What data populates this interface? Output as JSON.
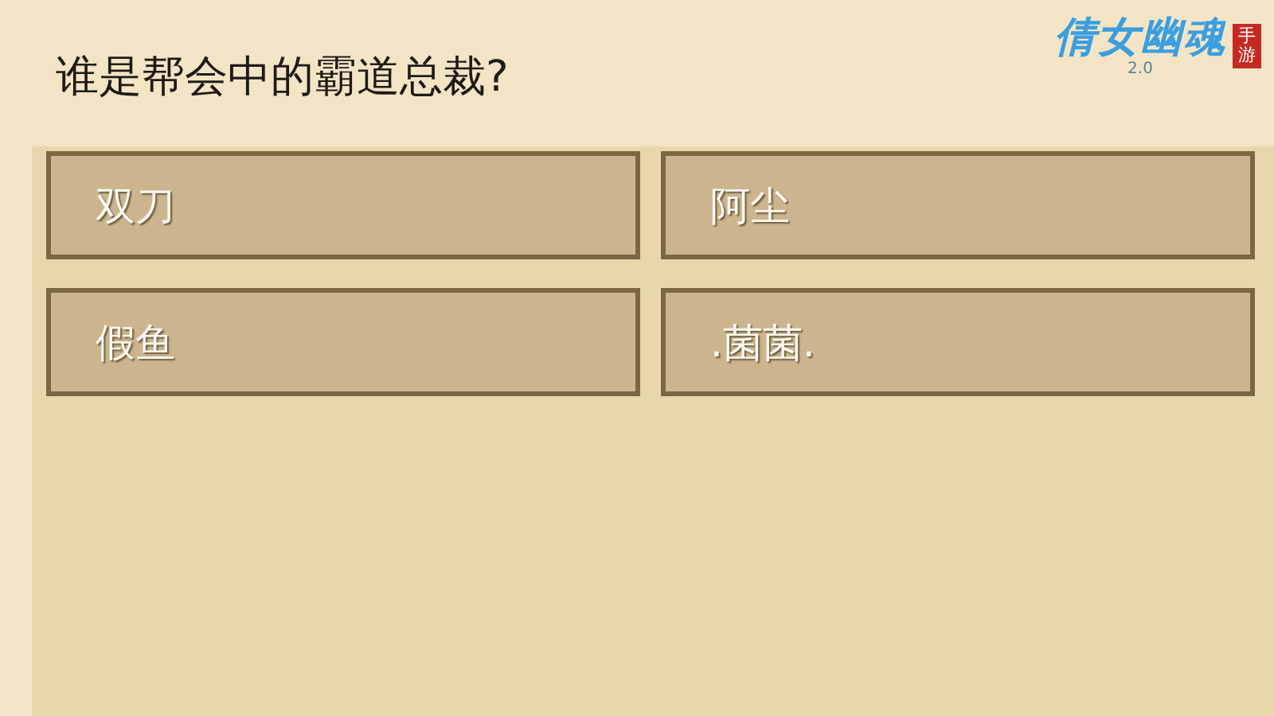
{
  "question": "谁是帮会中的霸道总裁?",
  "logo": {
    "title": "倩女幽魂",
    "version": "2.0",
    "badge": "手游"
  },
  "options": [
    {
      "label": "双刀"
    },
    {
      "label": "阿尘"
    },
    {
      "label": "假鱼"
    },
    {
      "label": ".菌菌."
    }
  ]
}
